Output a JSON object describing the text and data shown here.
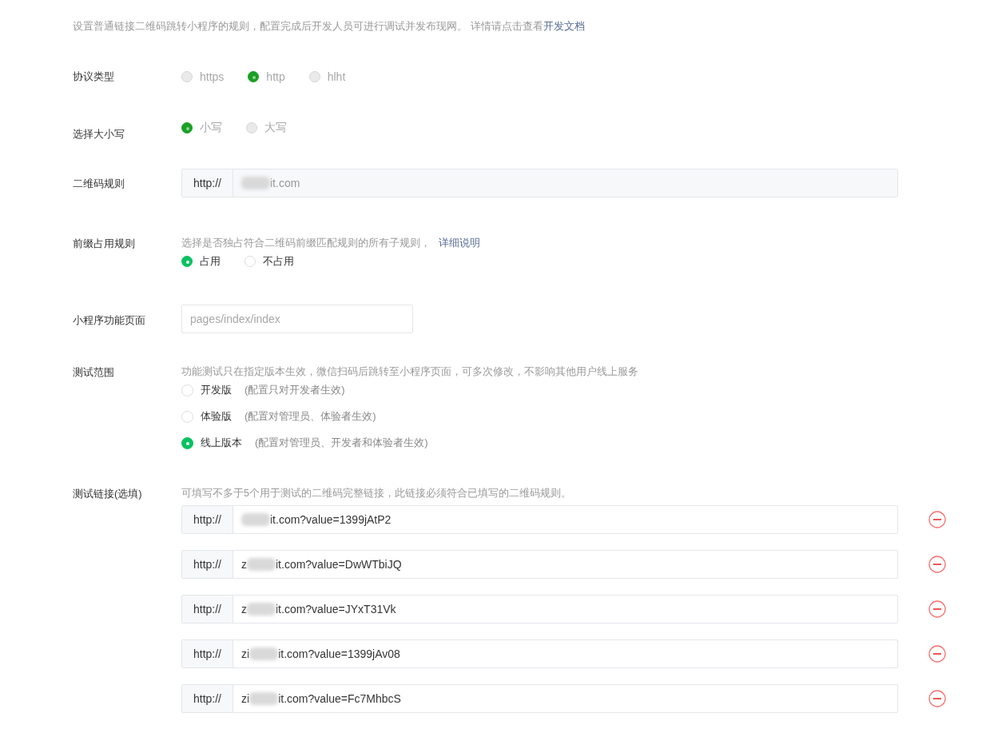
{
  "intro": {
    "text": "设置普通链接二维码跳转小程序的规则，配置完成后开发人员可进行调试并发布现网。 详情请点击查看",
    "link": "开发文档"
  },
  "sections": [
    {
      "kind": "radio",
      "label": "协议类型",
      "disabled": true,
      "options": [
        {
          "label": "https",
          "selected": false
        },
        {
          "label": "http",
          "selected": true
        },
        {
          "label": "hlht",
          "selected": false
        }
      ]
    },
    {
      "kind": "radio",
      "label": "选择大小写",
      "disabled": true,
      "options": [
        {
          "label": "小写",
          "selected": true
        },
        {
          "label": "大写",
          "selected": false
        }
      ]
    },
    {
      "kind": "prefixed_input",
      "label": "二维码规则",
      "disabled": true,
      "prefix": "http://",
      "value_end": "it.com",
      "redacted": true
    },
    {
      "kind": "radio",
      "label": "前缀占用规则",
      "disabled": false,
      "hint": "选择是否独占符合二维码前缀匹配规则的所有子规则，",
      "hint_link": "详细说明",
      "options": [
        {
          "label": "占用",
          "selected": true
        },
        {
          "label": "不占用",
          "selected": false
        }
      ]
    },
    {
      "kind": "input",
      "label": "小程序功能页面",
      "placeholder": "pages/index/index"
    },
    {
      "kind": "version_radio",
      "label": "测试范围",
      "hint": "功能测试只在指定版本生效，微信扫码后跳转至小程序页面，可多次修改，不影响其他用户线上服务",
      "options": [
        {
          "label": "开发版",
          "note": "(配置只对开发者生效)",
          "selected": false
        },
        {
          "label": "体验版",
          "note": "(配置对管理员、体验者生效)",
          "selected": false
        },
        {
          "label": "线上版本",
          "note": "(配置对管理员、开发者和体验者生效)",
          "selected": true
        }
      ]
    },
    {
      "kind": "links",
      "label": "测试链接(选填)",
      "hint": "可填写不多于5个用于测试的二维码完整链接，此链接必须符合已填写的二维码规则。",
      "links": [
        {
          "prefix": "http://",
          "value_end": "it.com?value=1399jAtP2",
          "redacted": true
        },
        {
          "prefix": "http://",
          "value_start": "z",
          "value_end": "it.com?value=DwWTbiJQ",
          "redacted": true
        },
        {
          "prefix": "http://",
          "value_start": "z",
          "value_end": "it.com?value=JYxT31Vk",
          "redacted": true
        },
        {
          "prefix": "http://",
          "value_start": "zi",
          "value_end": "it.com?value=1399jAv08",
          "redacted": true
        },
        {
          "prefix": "http://",
          "value_start": "zi",
          "value_end": "it.com?value=Fc7MhbcS",
          "redacted": true
        }
      ]
    }
  ]
}
